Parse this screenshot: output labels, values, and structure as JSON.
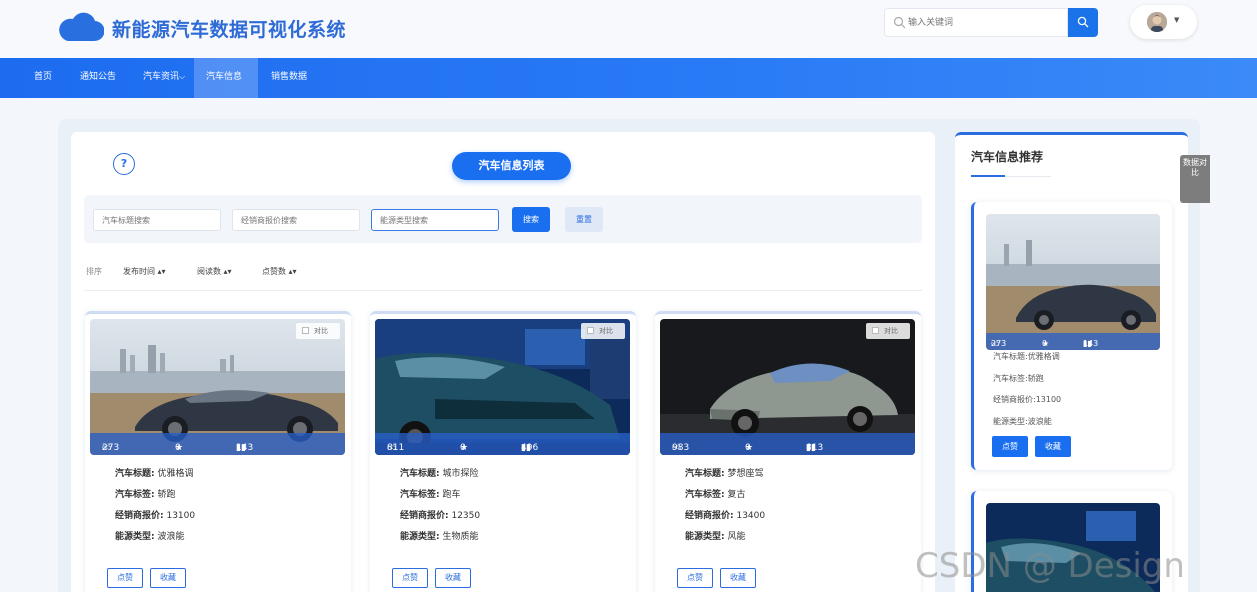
{
  "header": {
    "site_title": "新能源汽车数据可视化系统",
    "search_placeholder": "输入关键词"
  },
  "nav": {
    "items": [
      {
        "label": "首页"
      },
      {
        "label": "通知公告"
      },
      {
        "label": "汽车资讯"
      },
      {
        "label": "汽车信息",
        "active": true
      },
      {
        "label": "销售数据"
      }
    ]
  },
  "list": {
    "title": "汽车信息列表",
    "filters": {
      "title_placeholder": "汽车标题搜索",
      "price_placeholder": "经销商报价搜索",
      "energy_placeholder": "能源类型搜索",
      "search_label": "搜索",
      "reset_label": "重置"
    },
    "sort": {
      "label": "排序",
      "items": [
        "发布时间",
        "阅读数",
        "点赞数"
      ]
    },
    "field_labels": {
      "title": "汽车标题:",
      "tag": "汽车标签:",
      "price": "经销商报价:",
      "energy": "能源类型:"
    },
    "compare_label": "对比",
    "like_label": "点赞",
    "collect_label": "收藏",
    "cards": [
      {
        "likes": "273",
        "stars": "0",
        "views": "143",
        "title": "优雅格调",
        "tag": "轿跑",
        "price": "13100",
        "energy": "波浪能"
      },
      {
        "likes": "811",
        "stars": "0",
        "views": "496",
        "title": "城市探险",
        "tag": "跑车",
        "price": "12350",
        "energy": "生物质能"
      },
      {
        "likes": "983",
        "stars": "0",
        "views": "813",
        "title": "梦想座驾",
        "tag": "复古",
        "price": "13400",
        "energy": "风能"
      }
    ]
  },
  "recommend": {
    "title": "汽车信息推荐",
    "side_tab": "数据对比",
    "first": {
      "likes": "273",
      "stars": "0",
      "views": "143",
      "title_line": "汽车标题:优雅格调",
      "tag_line": "汽车标签:轿跑",
      "price_line": "经销商报价:13100",
      "energy_line": "能源类型:波浪能"
    },
    "like_label": "点赞",
    "collect_label": "收藏"
  },
  "watermark": "CSDN @ Design",
  "colors": {
    "primary": "#1a6ff0",
    "title_blue": "#2e6bd6",
    "nav_blue": "#2a7bf6"
  }
}
